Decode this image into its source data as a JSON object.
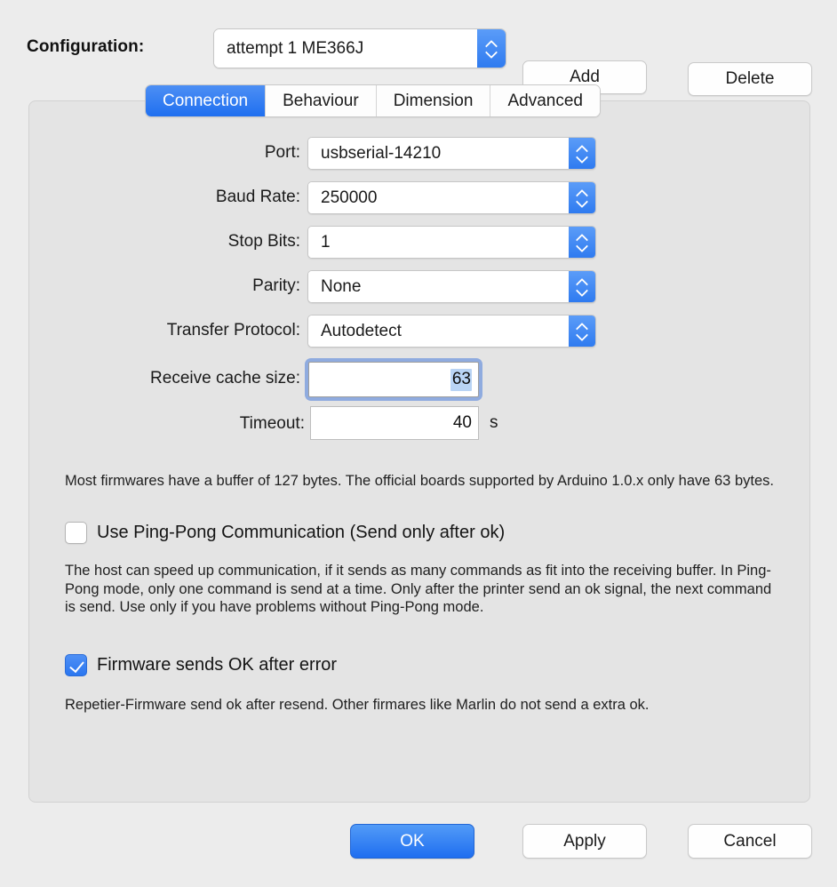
{
  "config": {
    "label": "Configuration:",
    "selected": "attempt 1 ME366J",
    "add_label": "Add",
    "delete_label": "Delete"
  },
  "tabs": [
    {
      "label": "Connection",
      "active": true
    },
    {
      "label": "Behaviour",
      "active": false
    },
    {
      "label": "Dimension",
      "active": false
    },
    {
      "label": "Advanced",
      "active": false
    }
  ],
  "fields": {
    "port": {
      "label": "Port:",
      "value": "usbserial-14210"
    },
    "baud": {
      "label": "Baud Rate:",
      "value": "250000"
    },
    "stopbits": {
      "label": "Stop Bits:",
      "value": "1"
    },
    "parity": {
      "label": "Parity:",
      "value": "None"
    },
    "protocol": {
      "label": "Transfer Protocol:",
      "value": "Autodetect"
    },
    "cache": {
      "label": "Receive cache size:",
      "value": "63"
    },
    "timeout": {
      "label": "Timeout:",
      "value": "40",
      "unit": "s"
    }
  },
  "help": {
    "buffer": "Most firmwares have a buffer of 127 bytes. The official boards supported by Arduino 1.0.x only have 63 bytes.",
    "pingpong": "The host can speed up communication, if it sends as many commands as fit into the receiving buffer. In Ping-Pong mode, only one command is send at a time. Only after the printer send an ok signal, the next command is send. Use only if you have problems without Ping-Pong mode.",
    "okafter": "Repetier-Firmware send ok after resend. Other firmares like Marlin do not send a extra ok."
  },
  "checkboxes": {
    "pingpong": {
      "label": "Use Ping-Pong Communication (Send only after ok)",
      "checked": false
    },
    "okerror": {
      "label": "Firmware sends OK after error",
      "checked": true
    }
  },
  "footer": {
    "ok_label": "OK",
    "apply_label": "Apply",
    "cancel_label": "Cancel"
  },
  "colors": {
    "accent": "#2f7bf0",
    "window_bg": "#ececec",
    "panel_bg": "#e4e4e4",
    "focus_ring": "#8fabdf",
    "selection": "#b9d4f5"
  }
}
